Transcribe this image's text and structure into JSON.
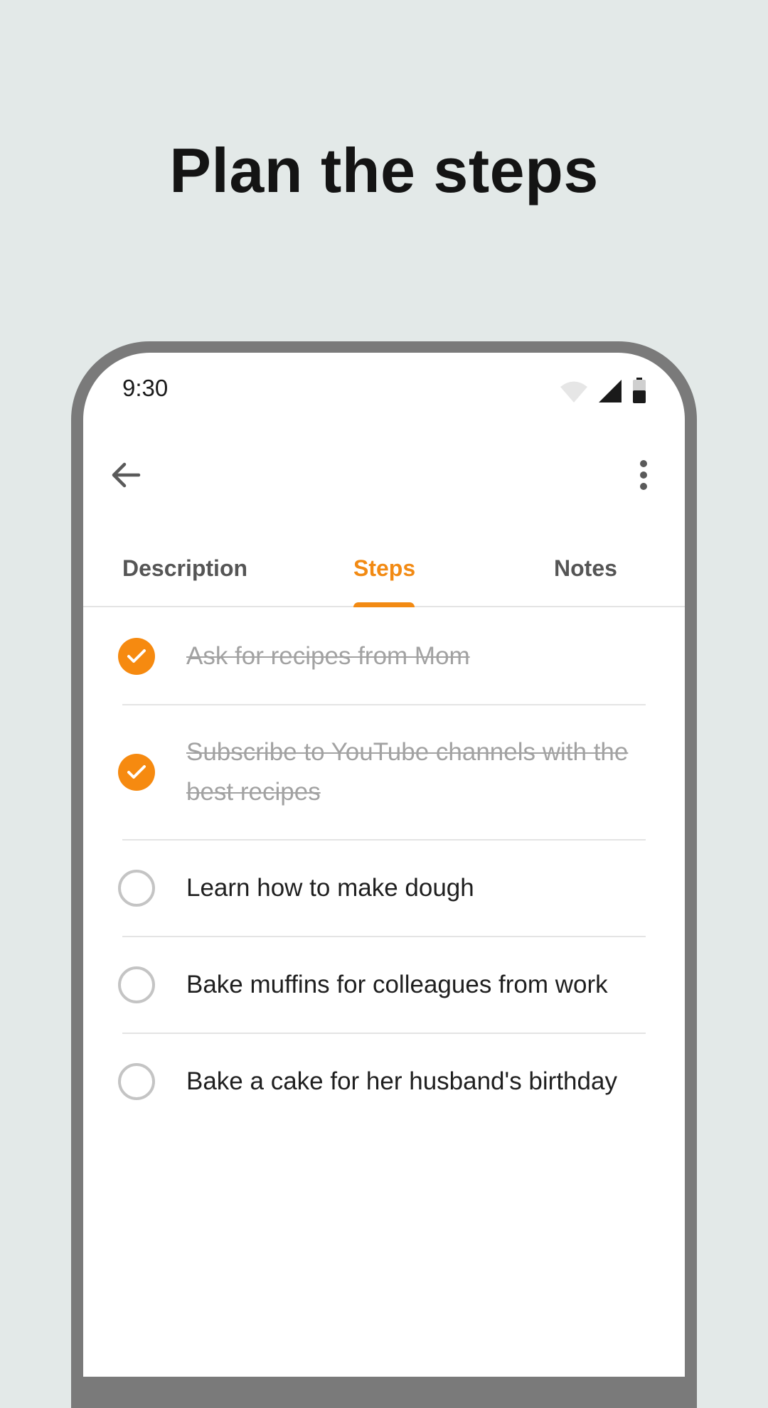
{
  "headline": "Plan the steps",
  "status_bar": {
    "time": "9:30",
    "icons": [
      "wifi-icon",
      "cell-signal-icon",
      "battery-icon"
    ]
  },
  "app_bar": {
    "back_icon": "arrow-left-icon",
    "menu_icon": "more-vertical-icon"
  },
  "tabs": [
    {
      "label": "Description",
      "selected": false
    },
    {
      "label": "Steps",
      "selected": true
    },
    {
      "label": "Notes",
      "selected": false
    }
  ],
  "steps": [
    {
      "text": "Ask for recipes from Mom",
      "done": true
    },
    {
      "text": "Subscribe to YouTube channels with the best recipes",
      "done": true
    },
    {
      "text": "Learn how to make dough",
      "done": false
    },
    {
      "text": "Bake muffins for colleagues from work",
      "done": false
    },
    {
      "text": "Bake a cake for her husband's birthday",
      "done": false
    }
  ],
  "colors": {
    "accent": "#f28a13",
    "background": "#e3e9e8",
    "frame": "#7a7a7a",
    "done_text": "#a2a2a2",
    "divider": "#e4e4e4"
  }
}
